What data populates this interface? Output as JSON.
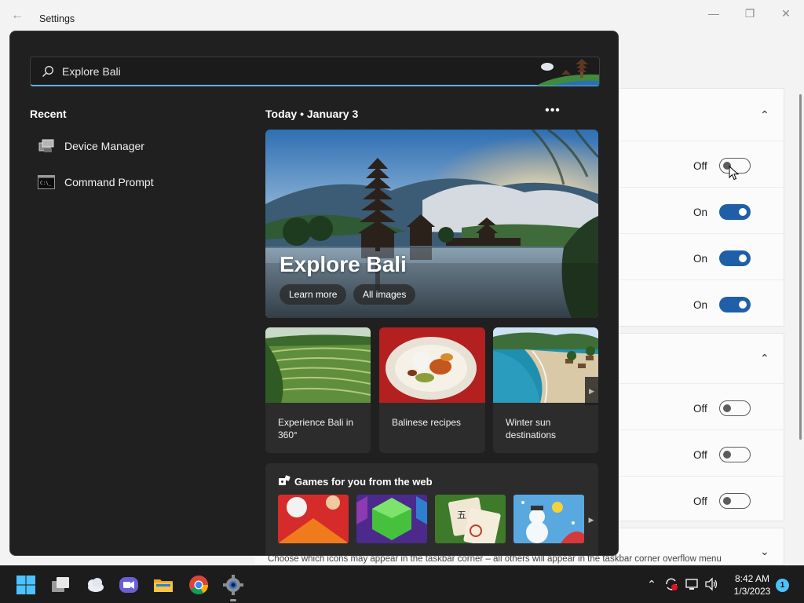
{
  "window": {
    "title": "Settings"
  },
  "settings": {
    "rows_a": [
      {
        "state": "Off"
      },
      {
        "state": "On"
      },
      {
        "state": "On"
      },
      {
        "state": "On"
      }
    ],
    "rows_b": [
      {
        "state": "Off"
      },
      {
        "state": "Off"
      },
      {
        "state": "Off"
      }
    ],
    "corner_caption": "Choose which icons may appear in the taskbar corner – all others will appear in the taskbar corner overflow menu"
  },
  "search": {
    "query": "Explore Bali",
    "recent_title": "Recent",
    "recent": [
      {
        "label": "Device Manager",
        "icon": "device-manager-icon"
      },
      {
        "label": "Command Prompt",
        "icon": "command-prompt-icon"
      }
    ],
    "today": "Today",
    "date": "January 3",
    "today_line": "Today  •  January 3",
    "hero": {
      "title": "Explore Bali",
      "learn_more": "Learn more",
      "all_images": "All images"
    },
    "tiles": [
      {
        "label": "Experience Bali in 360°"
      },
      {
        "label": "Balinese recipes"
      },
      {
        "label": "Winter sun destinations"
      }
    ],
    "games_title": "Games for you from the web"
  },
  "taskbar": {
    "time": "8:42 AM",
    "date": "1/3/2023",
    "notification_count": "1"
  },
  "colors": {
    "accent": "#1f5fa8",
    "flyout_bg": "#202020",
    "search_underline": "#5fb2e6",
    "taskbar_bg": "#1c1c1c",
    "badge": "#4cc2ff"
  }
}
